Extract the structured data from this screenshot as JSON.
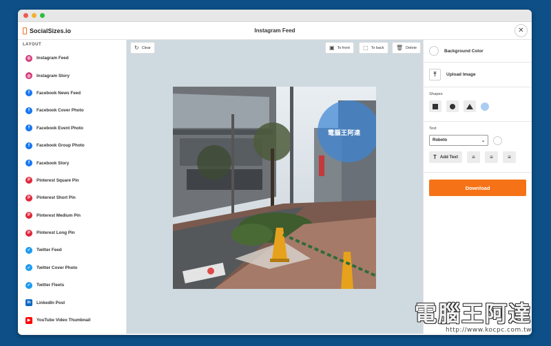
{
  "app": {
    "name": "SocialSizes.io",
    "page_title": "Instagram Feed",
    "close_icon": "close-icon"
  },
  "colors": {
    "window_red": "#ef5a52",
    "window_yellow": "#f1b12d",
    "window_green": "#28bf41",
    "brand": "#f26a1b",
    "download": "#f57316",
    "shape_swatch": "#a9cdf2",
    "instagram": "#d63a7a",
    "facebook": "#1877f2",
    "pinterest": "#e0273a",
    "twitter": "#1d9bf0",
    "linkedin": "#0a66c2",
    "youtube": "#ff0000"
  },
  "sidebar": {
    "heading": "LAYOUT",
    "items": [
      {
        "label": "Instagram Feed",
        "icon": "instagram-icon",
        "brand": "instagram"
      },
      {
        "label": "Instagram Story",
        "icon": "instagram-icon",
        "brand": "instagram"
      },
      {
        "label": "Facebook News Feed",
        "icon": "facebook-icon",
        "brand": "facebook"
      },
      {
        "label": "Facebook Cover Photo",
        "icon": "facebook-icon",
        "brand": "facebook"
      },
      {
        "label": "Facebook Event Photo",
        "icon": "facebook-icon",
        "brand": "facebook"
      },
      {
        "label": "Facebook Group Photo",
        "icon": "facebook-icon",
        "brand": "facebook"
      },
      {
        "label": "Facebook Story",
        "icon": "facebook-icon",
        "brand": "facebook"
      },
      {
        "label": "Pinterest Square Pin",
        "icon": "pinterest-icon",
        "brand": "pinterest"
      },
      {
        "label": "Pinterest Short Pin",
        "icon": "pinterest-icon",
        "brand": "pinterest"
      },
      {
        "label": "Pinterest Medium Pin",
        "icon": "pinterest-icon",
        "brand": "pinterest"
      },
      {
        "label": "Pinterest Long Pin",
        "icon": "pinterest-icon",
        "brand": "pinterest"
      },
      {
        "label": "Twitter Feed",
        "icon": "twitter-icon",
        "brand": "twitter"
      },
      {
        "label": "Twitter Cover Photo",
        "icon": "twitter-icon",
        "brand": "twitter"
      },
      {
        "label": "Twitter Fleets",
        "icon": "twitter-icon",
        "brand": "twitter"
      },
      {
        "label": "LinkedIn Post",
        "icon": "linkedin-icon",
        "brand": "linkedin"
      },
      {
        "label": "YouTube Video Thumbnail",
        "icon": "youtube-icon",
        "brand": "youtube"
      }
    ]
  },
  "toolbar": {
    "clear": "Clear",
    "to_front": "To front",
    "to_back": "To back",
    "delete": "Delete"
  },
  "canvas": {
    "caption_text": "電腦王阿達"
  },
  "panel": {
    "background_color": "Background Color",
    "upload_image": "Upload Image",
    "shapes_label": "Shapes",
    "text_label": "Text",
    "font_value": "Roboto",
    "add_text": "Add Text",
    "download": "Download"
  },
  "watermark": {
    "title": "電腦王阿達",
    "url": "http://www.kocpc.com.tw"
  }
}
